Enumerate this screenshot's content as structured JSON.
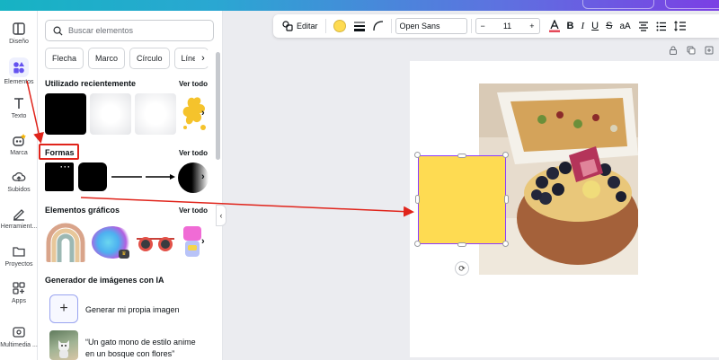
{
  "rail": {
    "items": [
      {
        "label": "Diseño"
      },
      {
        "label": "Elementos"
      },
      {
        "label": "Texto"
      },
      {
        "label": "Marca"
      },
      {
        "label": "Subidos"
      },
      {
        "label": "Herramient..."
      },
      {
        "label": "Proyectos"
      },
      {
        "label": "Apps"
      },
      {
        "label": "Multimedia ..."
      }
    ]
  },
  "panel": {
    "search_placeholder": "Buscar elementos",
    "chips": [
      "Flecha",
      "Marco",
      "Círculo",
      "Línea"
    ],
    "recent": {
      "title": "Utilizado recientemente",
      "see_all": "Ver todo"
    },
    "shapes": {
      "title": "Formas",
      "see_all": "Ver todo"
    },
    "graphics": {
      "title": "Elementos gráficos",
      "see_all": "Ver todo"
    },
    "ai": {
      "title": "Generador de imágenes con IA",
      "generate_label": "Generar mi propia imagen",
      "prompt_line1": "“Un gato mono de estilo anime",
      "prompt_line2": "en un bosque con flores”"
    }
  },
  "toolbar": {
    "edit_label": "Editar",
    "font": "Open Sans",
    "font_size": "11",
    "case_label": "aA",
    "color_swatch": "#fedb52"
  },
  "colors": {
    "accent": "#8b3dff",
    "shape_fill": "#fedb52",
    "annotation": "#e0241b"
  }
}
